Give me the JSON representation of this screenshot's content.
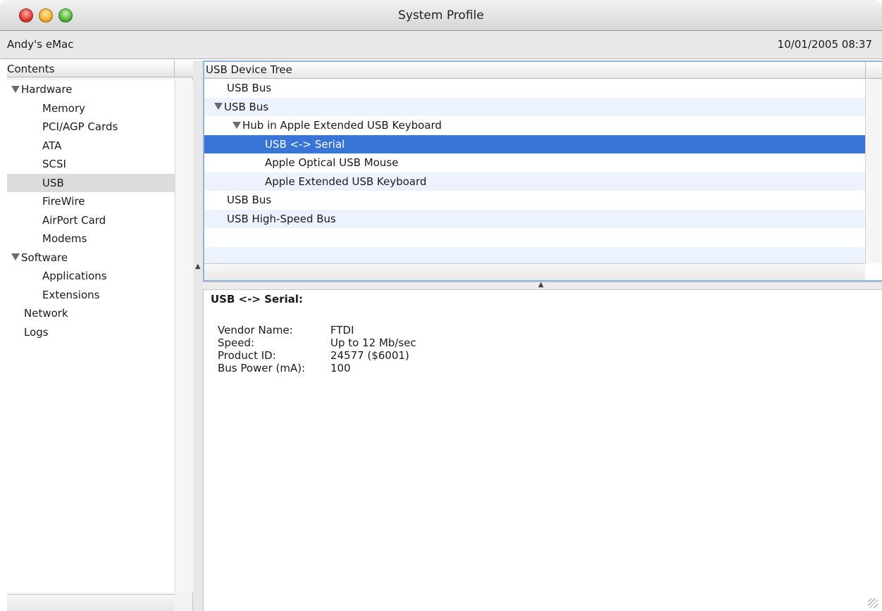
{
  "window": {
    "title": "System Profile"
  },
  "infobar": {
    "computer_name": "Andy's eMac",
    "datetime": "10/01/2005 08:37"
  },
  "sidebar": {
    "header": "Contents",
    "items": [
      {
        "label": "Hardware",
        "level": 0,
        "expanded": true
      },
      {
        "label": "Memory",
        "level": 1
      },
      {
        "label": "PCI/AGP Cards",
        "level": 1
      },
      {
        "label": "ATA",
        "level": 1
      },
      {
        "label": "SCSI",
        "level": 1
      },
      {
        "label": "USB",
        "level": 1,
        "selected": true
      },
      {
        "label": "FireWire",
        "level": 1
      },
      {
        "label": "AirPort Card",
        "level": 1
      },
      {
        "label": "Modems",
        "level": 1
      },
      {
        "label": "Software",
        "level": 0,
        "expanded": true
      },
      {
        "label": "Applications",
        "level": 1
      },
      {
        "label": "Extensions",
        "level": 1
      },
      {
        "label": "Network",
        "level": 0
      },
      {
        "label": "Logs",
        "level": 0
      }
    ]
  },
  "device_tree": {
    "header": "USB Device Tree",
    "rows": [
      {
        "label": "USB Bus",
        "level": 0
      },
      {
        "label": "USB Bus",
        "level": 0,
        "expanded": true
      },
      {
        "label": "Hub in Apple Extended USB Keyboard",
        "level": 1,
        "expanded": true
      },
      {
        "label": "USB <-> Serial",
        "level": 2,
        "selected": true
      },
      {
        "label": "Apple Optical USB Mouse",
        "level": 2
      },
      {
        "label": "Apple Extended USB Keyboard",
        "level": 2
      },
      {
        "label": "USB Bus",
        "level": 0
      },
      {
        "label": "USB High-Speed Bus",
        "level": 0
      }
    ]
  },
  "detail": {
    "title": "USB <-> Serial:",
    "properties": [
      {
        "label": "Vendor Name:",
        "value": "FTDI"
      },
      {
        "label": "Speed:",
        "value": "Up to 12 Mb/sec"
      },
      {
        "label": "Product ID:",
        "value": "24577 ($6001)"
      },
      {
        "label": "Bus Power (mA):",
        "value": "100"
      }
    ]
  },
  "colors": {
    "selection": "#3875d7",
    "alt_row": "#edf3fe",
    "sidebar_selection": "#dcdcdc"
  }
}
